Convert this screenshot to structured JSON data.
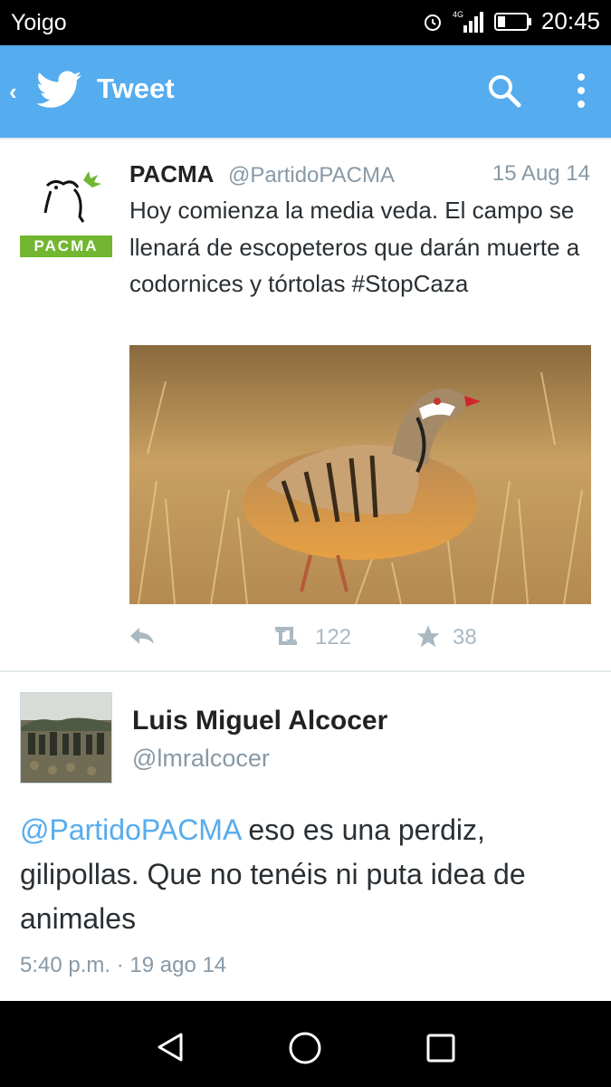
{
  "status_bar": {
    "carrier": "Yoigo",
    "network": "4G",
    "time": "20:45"
  },
  "app_bar": {
    "title": "Tweet",
    "icons": [
      "back-icon",
      "twitter-bird-icon",
      "search-icon",
      "more-vert-icon"
    ]
  },
  "tweet": {
    "author_name": "PACMA",
    "handle": "@PartidoPACMA",
    "date": "15 Aug 14",
    "logo_text": "PACMA",
    "text": "Hoy comienza la media veda. El campo se llenará de escopeteros que darán muerte a codornices y tórtolas #StopCaza",
    "retweets": "122",
    "favorites": "38"
  },
  "reply": {
    "author_name": "Luis Miguel Alcocer",
    "handle": "@lmralcocer",
    "mention": "@PartidoPACMA",
    "text": " eso es una perdiz, gilipollas. Que no tenéis ni puta idea de animales",
    "timestamp": "5:40 p.m. · 19 ago 14"
  },
  "nav_bar": {
    "icons": [
      "nav-back-icon",
      "nav-home-icon",
      "nav-recents-icon"
    ]
  },
  "colors": {
    "twitter_blue": "#55acee",
    "pacma_green": "#72b631",
    "muted_text": "#8899a6"
  }
}
